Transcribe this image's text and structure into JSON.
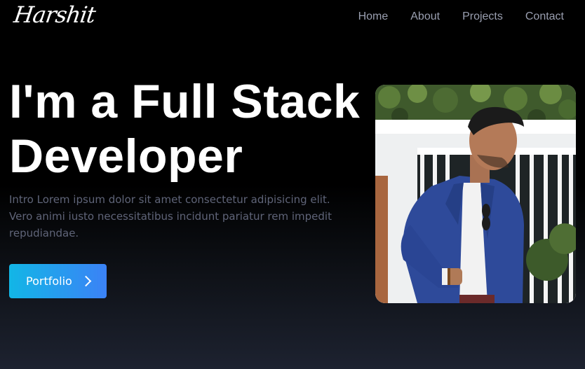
{
  "nav": {
    "logo": "Harshit",
    "links": [
      {
        "label": "Home"
      },
      {
        "label": "About"
      },
      {
        "label": "Projects"
      },
      {
        "label": "Contact"
      }
    ]
  },
  "hero": {
    "title_line1": "I'm a Full Stack",
    "title_line2": "Developer",
    "intro": "Intro Lorem ipsum dolor sit amet consectetur adipisicing elit. Vero animi iusto necessitatibus incidunt pariatur rem impedit repudiandae.",
    "button_label": "Portfolio",
    "button_icon": "chevron-right-icon"
  },
  "colors": {
    "background_top": "#000000",
    "background_bottom": "#1d2230",
    "nav_link": "#9a9fb0",
    "intro_text": "#5f6478",
    "button_gradient_start": "#12b6e6",
    "button_gradient_end": "#3b82f6"
  }
}
